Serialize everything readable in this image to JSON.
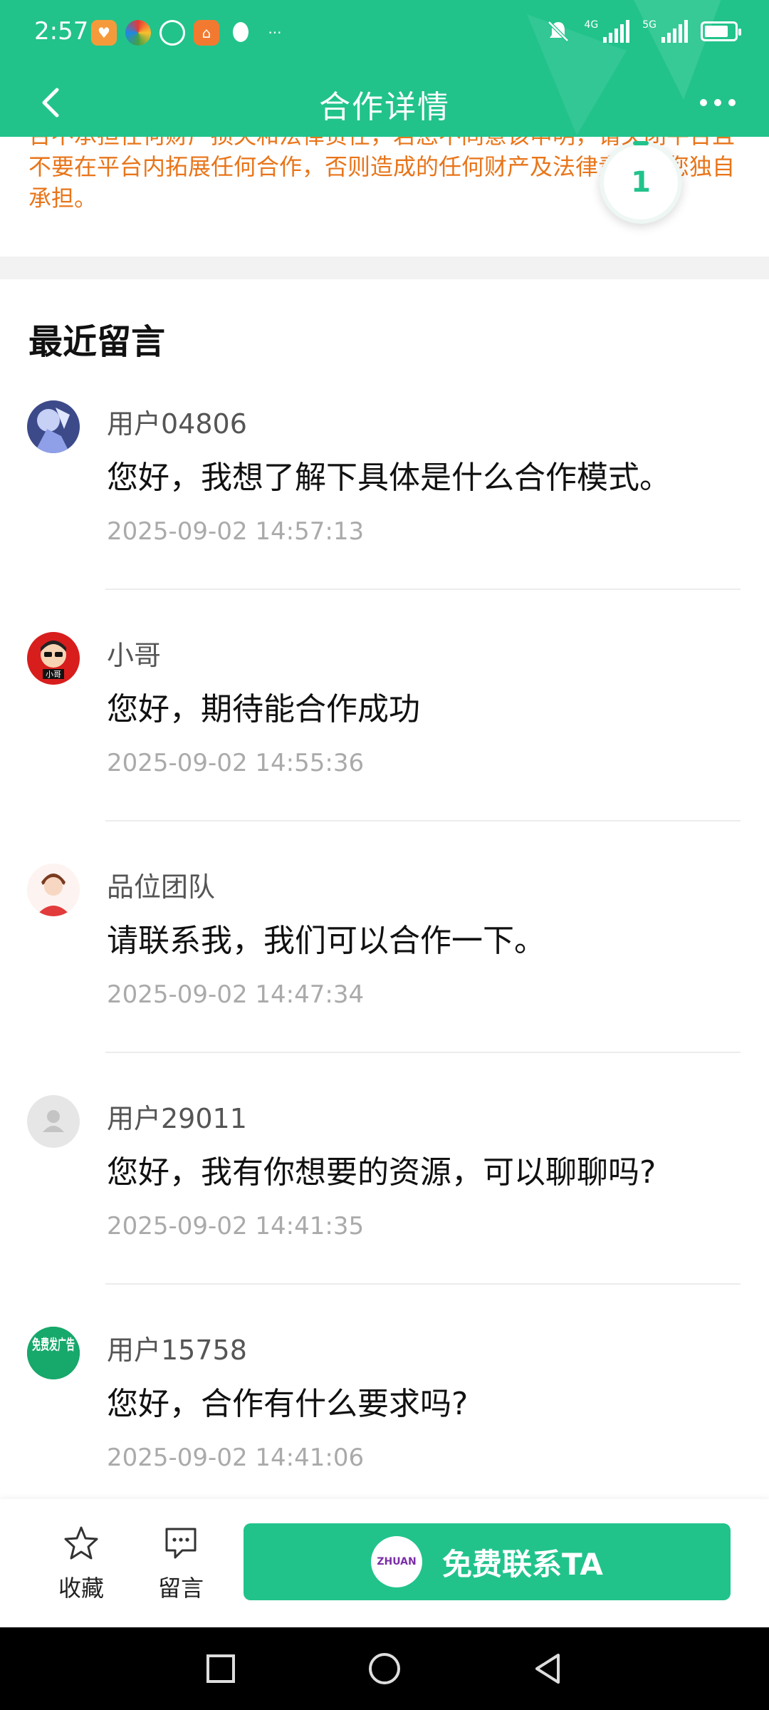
{
  "status_bar": {
    "time": "2:57",
    "signal1_label": "4G",
    "signal2_label": "5G"
  },
  "header": {
    "title": "合作详情"
  },
  "disclaimer": {
    "text": "台不承担任何财产损失和法律责任，若您不同意该申明，请关闭平台且不要在平台内拓展任何合作，否则造成的任何财产及法律责任由您独自承担。"
  },
  "float_badge": {
    "count": "1"
  },
  "comments_section": {
    "title": "最近留言",
    "items": [
      {
        "user": "用户04806",
        "text": "您好，我想了解下具体是什么合作模式。",
        "time": "2025-09-02 14:57:13"
      },
      {
        "user": "小哥",
        "text": "您好，期待能合作成功",
        "time": "2025-09-02 14:55:36",
        "avatar_text": "小哥"
      },
      {
        "user": "品位团队",
        "text": "请联系我，我们可以合作一下。",
        "time": "2025-09-02 14:47:34"
      },
      {
        "user": "用户29011",
        "text": "您好，我有你想要的资源，可以聊聊吗?",
        "time": "2025-09-02 14:41:35"
      },
      {
        "user": "用户15758",
        "text": "您好，合作有什么要求吗?",
        "time": "2025-09-02 14:41:06",
        "avatar_text": "免费发广告"
      }
    ]
  },
  "bottom_bar": {
    "favorite_label": "收藏",
    "message_label": "留言",
    "cta_label": "免费联系TA",
    "cta_logo_text": "ZHUAN"
  },
  "colors": {
    "brand_green": "#21c38b",
    "warning_orange": "#e8751a"
  }
}
